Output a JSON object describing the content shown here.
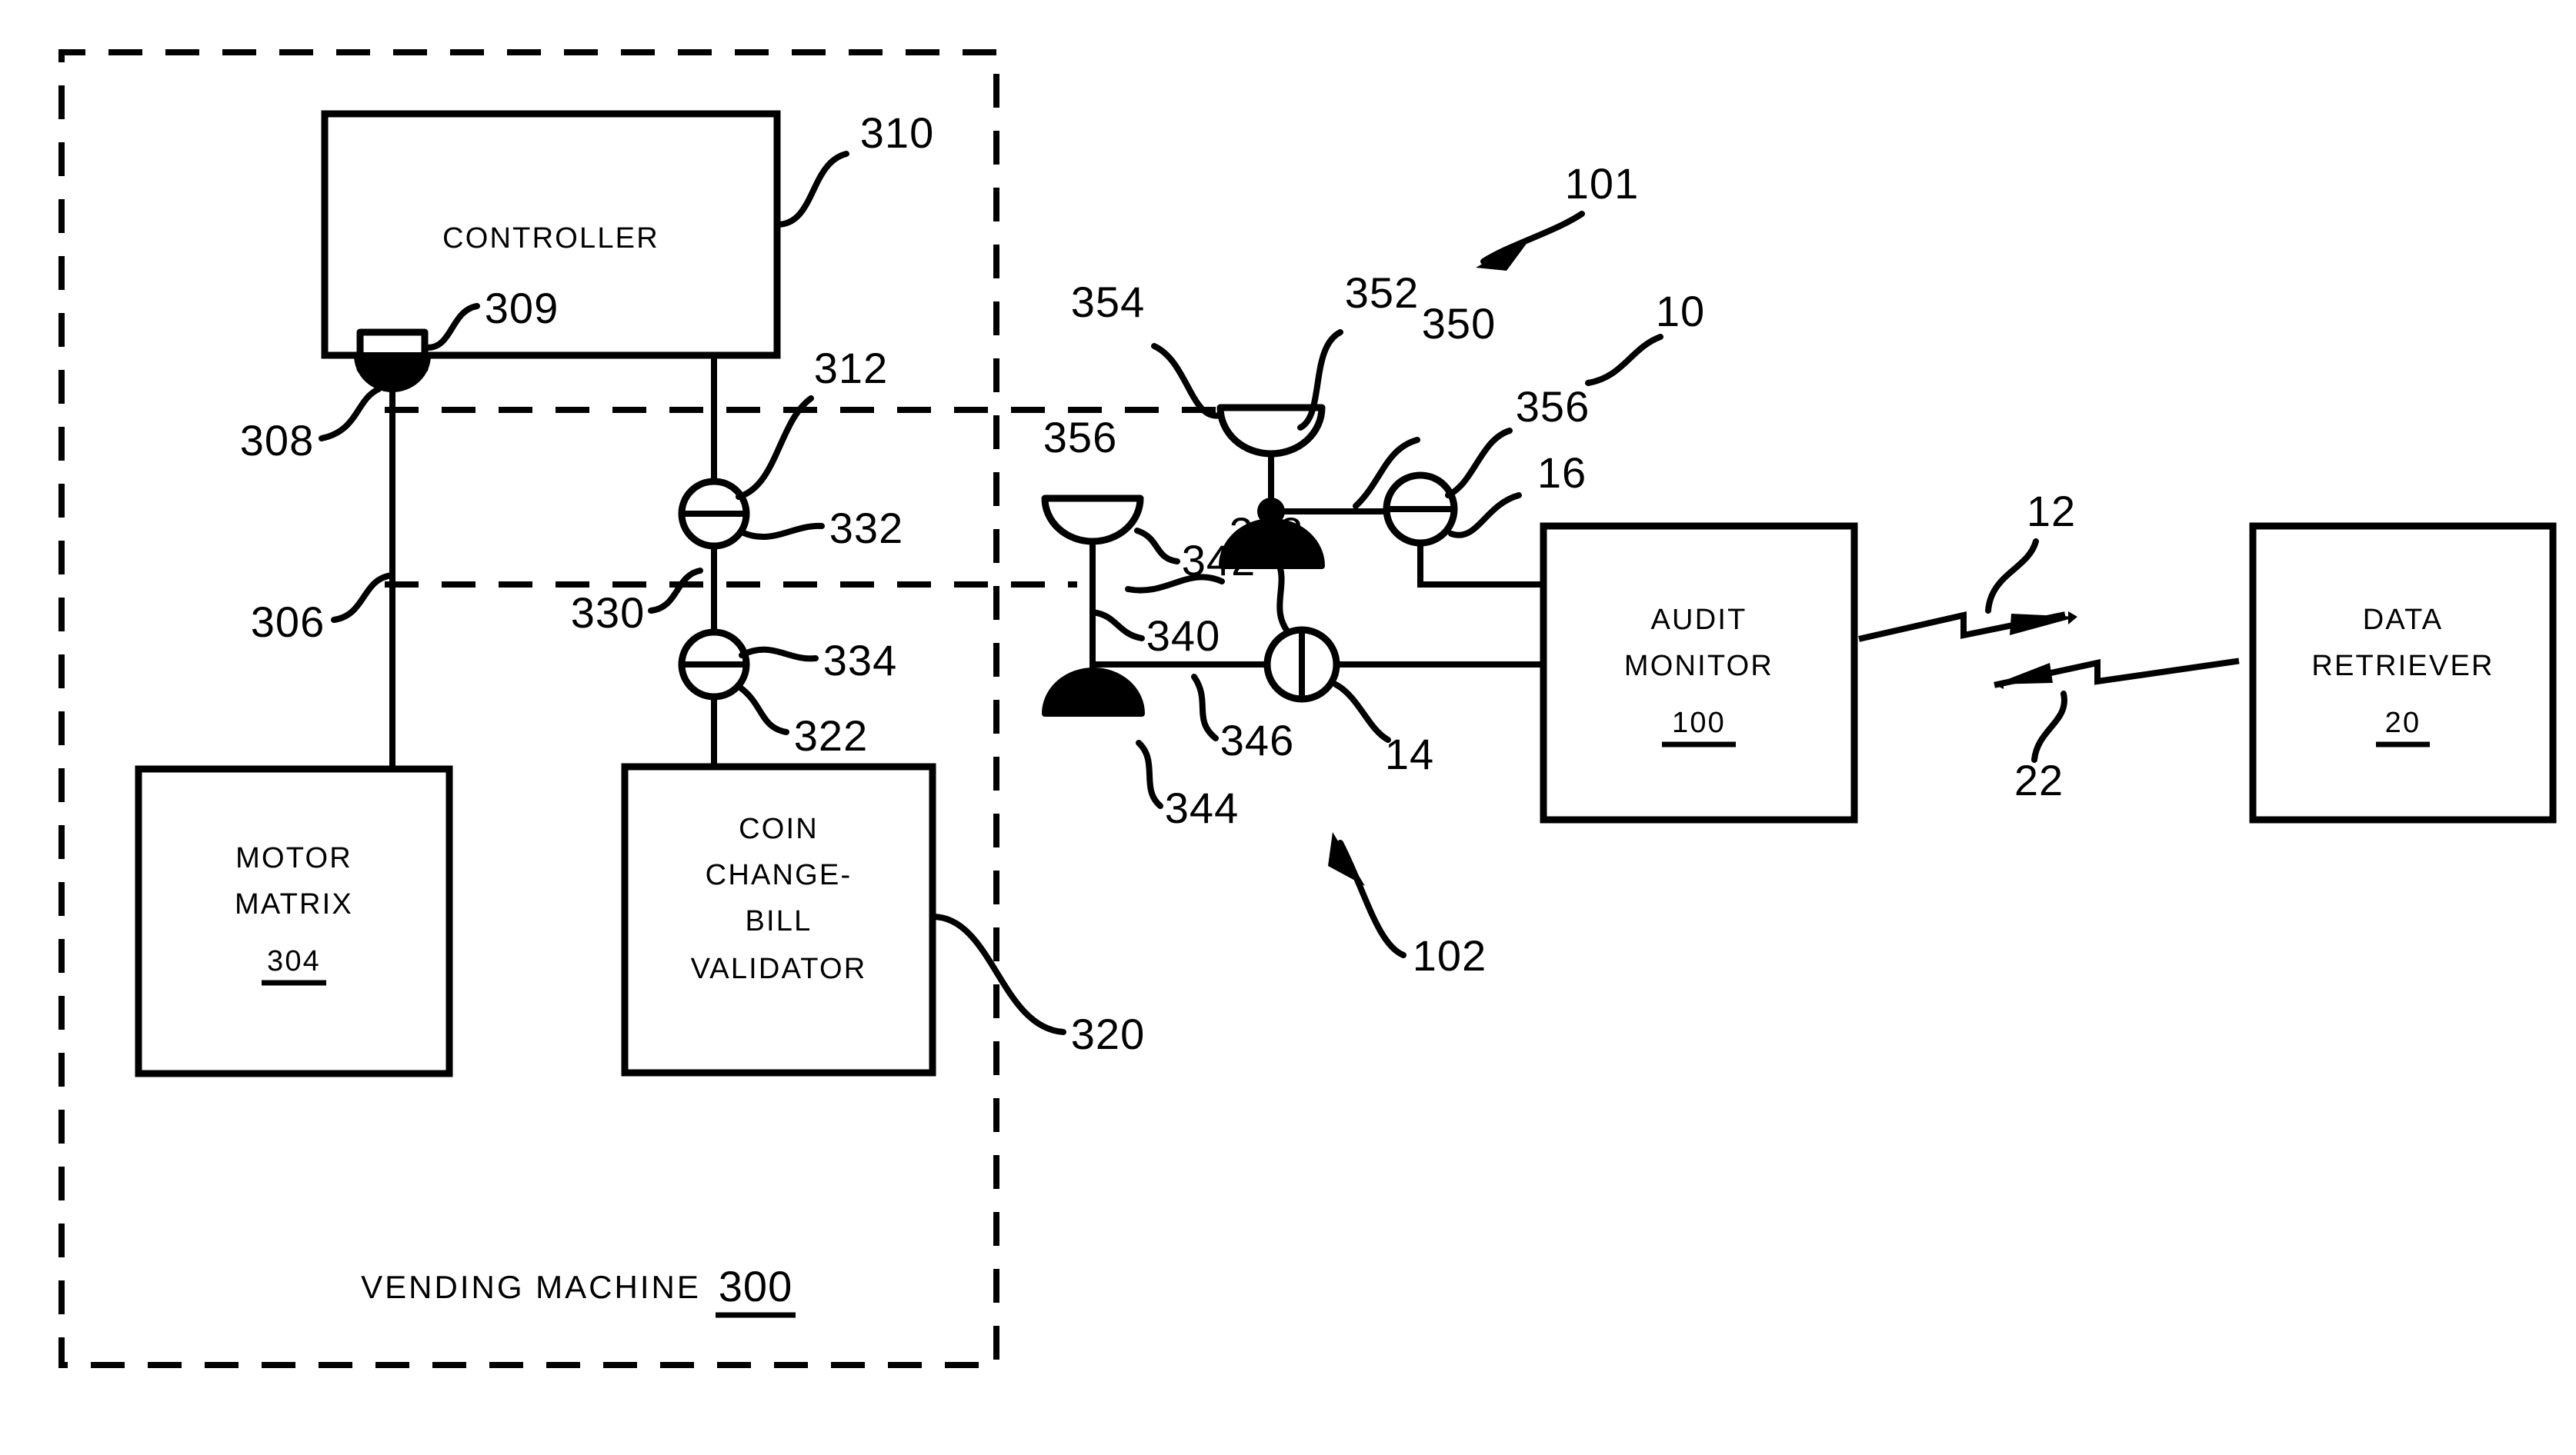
{
  "figure": {
    "caption": "VENDING MACHINE",
    "caption_ref": "300"
  },
  "blocks": [
    {
      "id": "controller",
      "lines": [
        "CONTROLLER"
      ],
      "ref": "",
      "ref_underlined": false
    },
    {
      "id": "motor-matrix",
      "lines": [
        "MOTOR",
        "MATRIX"
      ],
      "ref": "304",
      "ref_underlined": true
    },
    {
      "id": "coin-validator",
      "lines": [
        "COIN",
        "CHANGE-",
        "BILL",
        "VALIDATOR"
      ],
      "ref": "",
      "ref_underlined": false
    },
    {
      "id": "audit-monitor",
      "lines": [
        "AUDIT",
        "MONITOR"
      ],
      "ref": "100",
      "ref_underlined": true
    },
    {
      "id": "data-retriever",
      "lines": [
        "DATA",
        "RETRIEVER"
      ],
      "ref": "20",
      "ref_underlined": true
    }
  ],
  "reference_numerals": {
    "r310": "310",
    "r309": "309",
    "r308": "308",
    "r306": "306",
    "r312": "312",
    "r332": "332",
    "r330": "330",
    "r334": "334",
    "r322": "322",
    "r320": "320",
    "r354": "354",
    "r352": "352",
    "r350": "350",
    "r356a": "356",
    "r356b": "356",
    "r101": "101",
    "r10": "10",
    "r16": "16",
    "r342": "342",
    "r340": "340",
    "r348": "348",
    "r344": "344",
    "r346": "346",
    "r14": "14",
    "r102": "102",
    "r12": "12",
    "r22": "22"
  },
  "colors": {
    "ink": "#000000",
    "paper": "#ffffff"
  }
}
